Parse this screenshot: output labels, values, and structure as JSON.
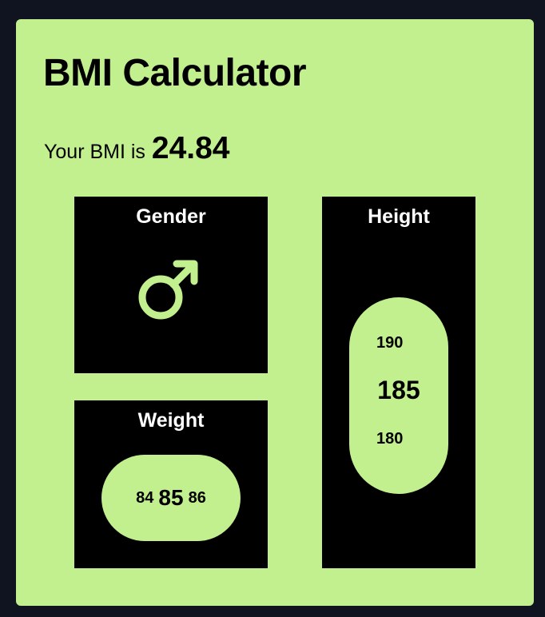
{
  "app": {
    "title": "BMI Calculator"
  },
  "result": {
    "prefix": "Your BMI is",
    "value": "24.84"
  },
  "gender": {
    "label": "Gender",
    "icon": "male-symbol-icon"
  },
  "weight": {
    "label": "Weight",
    "prev": "84",
    "current": "85",
    "next": "86"
  },
  "height": {
    "label": "Height",
    "above": "190",
    "current": "185",
    "below": "180"
  },
  "colors": {
    "accent": "#c2f08e",
    "panel": "#000000",
    "background": "#0f1420"
  }
}
